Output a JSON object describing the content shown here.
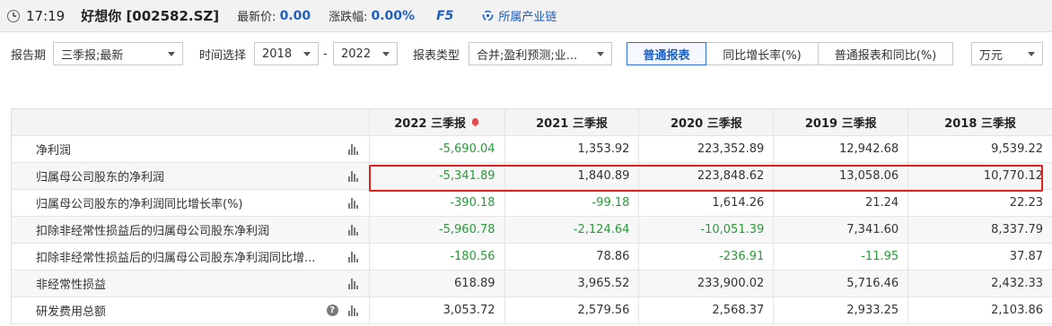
{
  "header": {
    "time": "17:19",
    "stock": "好想你 [002582.SZ]",
    "latest_label": "最新价:",
    "latest_value": "0.00",
    "change_label": "涨跌幅:",
    "change_value": "0.00%",
    "f5": "F5",
    "industry_chain": "所属产业链"
  },
  "controls": {
    "period_label": "报告期",
    "period_value": "三季报;最新",
    "time_label": "时间选择",
    "year_from": "2018",
    "dash": "-",
    "year_to": "2022",
    "type_label": "报表类型",
    "type_value": "合并;盈利预测;业...",
    "buttons": [
      "普通报表",
      "同比增长率(%)",
      "普通报表和同比(%)"
    ],
    "unit": "万元"
  },
  "table": {
    "columns": [
      "2022 三季报",
      "2021 三季报",
      "2020 三季报",
      "2019 三季报",
      "2018 三季报"
    ],
    "rows": [
      {
        "label": "净利润",
        "values": [
          "-5,690.04",
          "1,353.92",
          "223,352.89",
          "12,942.68",
          "9,539.22"
        ]
      },
      {
        "label": "归属母公司股东的净利润",
        "values": [
          "-5,341.89",
          "1,840.89",
          "223,848.62",
          "13,058.06",
          "10,770.12"
        ]
      },
      {
        "label": "归属母公司股东的净利润同比增长率(%)",
        "values": [
          "-390.18",
          "-99.18",
          "1,614.26",
          "21.24",
          "22.23"
        ]
      },
      {
        "label": "扣除非经常性损益后的归属母公司股东净利润",
        "values": [
          "-5,960.78",
          "-2,124.64",
          "-10,051.39",
          "7,341.60",
          "8,337.79"
        ]
      },
      {
        "label": "扣除非经常性损益后的归属母公司股东净利润同比增...",
        "values": [
          "-180.56",
          "78.86",
          "-236.91",
          "-11.95",
          "37.87"
        ]
      },
      {
        "label": "非经常性损益",
        "values": [
          "618.89",
          "3,965.52",
          "233,900.02",
          "5,716.46",
          "2,432.33"
        ]
      },
      {
        "label": "研发费用总额",
        "values": [
          "3,053.72",
          "2,579.56",
          "2,568.37",
          "2,933.25",
          "2,103.86"
        ]
      }
    ]
  },
  "colors": {
    "accent": "#1f5fbf",
    "negative": "#2a9a3a",
    "highlight": "#e02020"
  }
}
